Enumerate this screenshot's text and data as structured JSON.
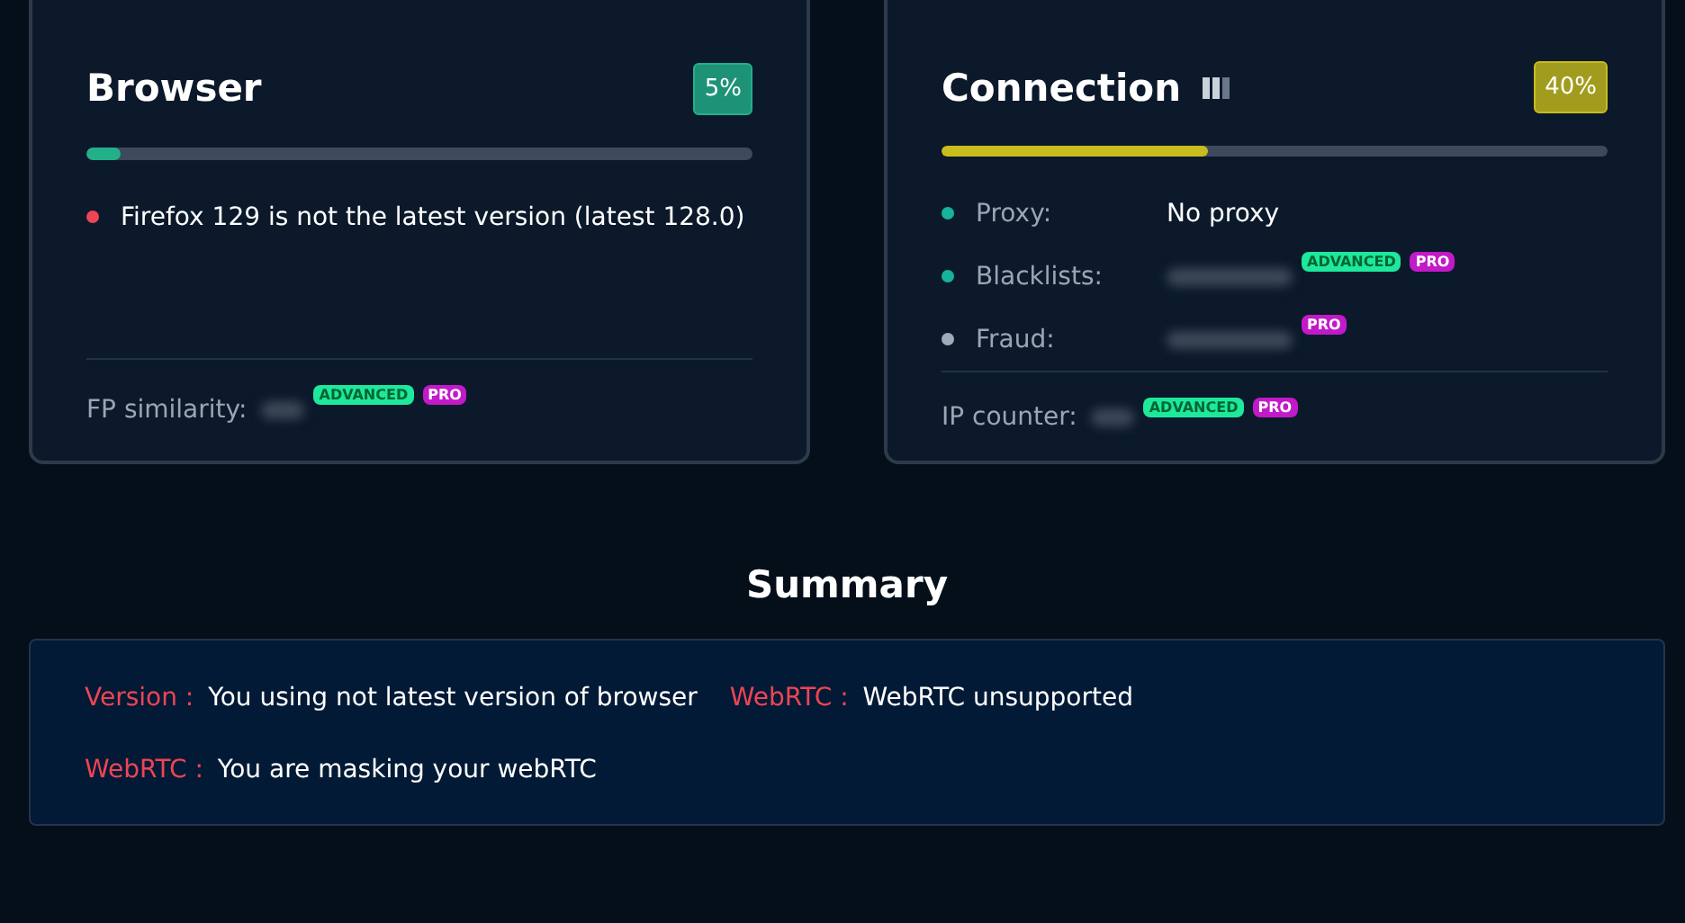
{
  "cards": [
    {
      "title": "Browser",
      "show_bars_icon": false,
      "percent": "5%",
      "level": 0.05,
      "color": "#22b08a",
      "items": [
        {
          "kind": "note",
          "color": "#ef4455",
          "text": "Firefox 129 is not the latest version (latest 128.0)"
        }
      ],
      "footer": {
        "label": "FP similarity:",
        "blurred": true,
        "badges": [
          "ADVANCED",
          "PRO"
        ]
      }
    },
    {
      "title": "Connection",
      "show_bars_icon": true,
      "percent": "40%",
      "level": 0.4,
      "color": "#c8bd1c",
      "items": [
        {
          "kind": "field",
          "color": "#16b39a",
          "label": "Proxy:",
          "value": "No proxy"
        },
        {
          "kind": "field",
          "color": "#16b39a",
          "label": "Blacklists:",
          "blurred": true,
          "badges": [
            "ADVANCED",
            "PRO"
          ]
        },
        {
          "kind": "field",
          "color": "#a0aab8",
          "label": "Fraud:",
          "blurred": true,
          "badges": [
            "PRO"
          ]
        }
      ],
      "footer": {
        "label": "IP counter:",
        "blurred": true,
        "badges": [
          "ADVANCED",
          "PRO"
        ]
      }
    }
  ],
  "summary": {
    "title": "Summary",
    "rows": [
      [
        {
          "key": "Version :",
          "value": "You using not latest version of browser"
        },
        {
          "key": "WebRTC :",
          "value": "WebRTC unsupported"
        }
      ],
      [
        {
          "key": "WebRTC :",
          "value": "You are masking your webRTC"
        }
      ]
    ]
  }
}
